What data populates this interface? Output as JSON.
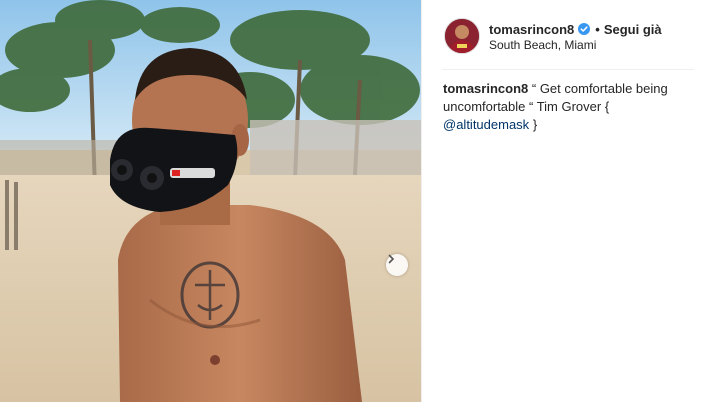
{
  "post": {
    "username": "tomasrincon8",
    "follow_label": "Segui già",
    "separator": "•",
    "location": "South Beach, Miami",
    "caption": {
      "username": "tomasrincon8",
      "text_before_mention": "“ Get comfortable being uncomfortable “ Tim Grover {",
      "mention": "@altitudemask",
      "text_after_mention": "}"
    }
  },
  "icons": {
    "verified": "verified-badge-icon",
    "next": "chevron-right-icon"
  },
  "colors": {
    "verified_blue": "#3897f0",
    "mention_link": "#003569",
    "text": "#262626",
    "divider": "#efefef"
  }
}
